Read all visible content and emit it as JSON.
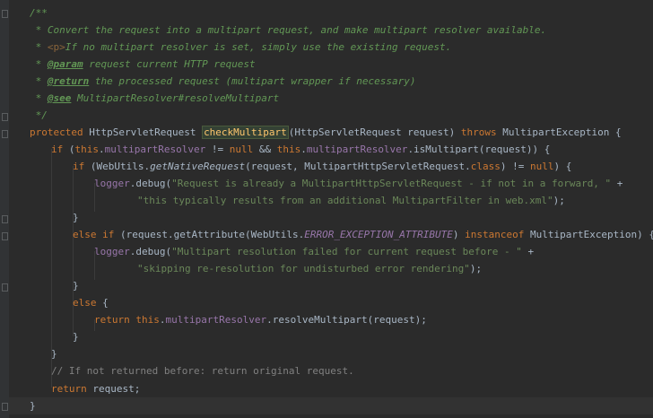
{
  "code": {
    "line1": {
      "t1": "/**"
    },
    "line2": {
      "t1": " * Convert the request into a multipart request, and make multipart resolver available."
    },
    "line3": {
      "t1": " * ",
      "tag": "<p>",
      "t2": "If no multipart resolver is set, simply use the existing request."
    },
    "line4": {
      "t1": " * ",
      "tag": "@param",
      "t2": " request current HTTP request"
    },
    "line5": {
      "t1": " * ",
      "tag": "@return",
      "t2": " the processed request (multipart wrapper if necessary)"
    },
    "line6": {
      "t1": " * ",
      "tag": "@see",
      "t2": " MultipartResolver#resolveMultipart"
    },
    "line7": {
      "t1": " */"
    },
    "line8": {
      "kw": "protected",
      "t1": " HttpServletRequest ",
      "method": "checkMultipart",
      "t2": "(HttpServletRequest request) ",
      "kw2": "throws",
      "t3": " MultipartException {"
    },
    "line9": {
      "kw": "if",
      "t1": " (",
      "kw2": "this",
      "t2": ".",
      "f1": "multipartResolver",
      "t3": " != ",
      "kw3": "null",
      "t4": " && ",
      "kw4": "this",
      "t5": ".",
      "f2": "multipartResolver",
      "t6": ".isMultipart(request)) {"
    },
    "line10": {
      "kw": "if",
      "t1": " (WebUtils.",
      "m": "getNativeRequest",
      "t2": "(request, MultipartHttpServletRequest.",
      "kw2": "class",
      "t3": ") != ",
      "kw3": "null",
      "t4": ") {"
    },
    "line11": {
      "f": "logger",
      "t1": ".debug(",
      "s": "\"Request is already a MultipartHttpServletRequest - if not in a forward, \"",
      "t2": " +"
    },
    "line12": {
      "s": "\"this typically results from an additional MultipartFilter in web.xml\"",
      "t1": ");"
    },
    "line13": {
      "t1": "}"
    },
    "line14": {
      "kw": "else if",
      "t1": " (request.getAttribute(WebUtils.",
      "c": "ERROR_EXCEPTION_ATTRIBUTE",
      "t2": ") ",
      "kw2": "instanceof",
      "t3": " MultipartException) {"
    },
    "line15": {
      "f": "logger",
      "t1": ".debug(",
      "s": "\"Multipart resolution failed for current request before - \"",
      "t2": " +"
    },
    "line16": {
      "s": "\"skipping re-resolution for undisturbed error rendering\"",
      "t1": ");"
    },
    "line17": {
      "t1": "}"
    },
    "line18": {
      "kw": "else",
      "t1": " {"
    },
    "line19": {
      "kw": "return",
      "t1": " ",
      "kw2": "this",
      "t2": ".",
      "f": "multipartResolver",
      "t3": ".resolveMultipart(request);"
    },
    "line20": {
      "t1": "}"
    },
    "line21": {
      "t1": "}"
    },
    "line22": {
      "c": "// If not returned before: return original request."
    },
    "line23": {
      "kw": "return",
      "t1": " request;"
    },
    "line24": {
      "t1": "}"
    }
  }
}
